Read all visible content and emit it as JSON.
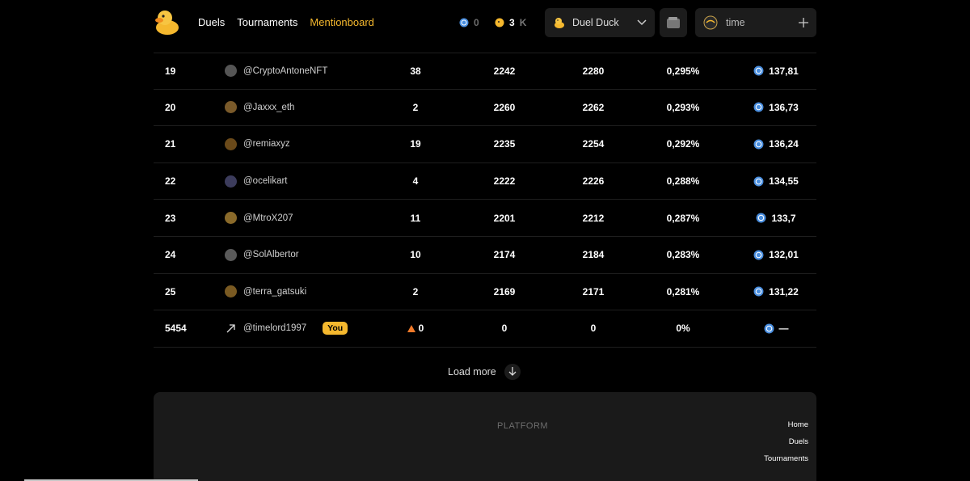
{
  "nav": {
    "items": [
      "Duels",
      "Tournaments",
      "Mentionboard"
    ],
    "active": 2
  },
  "balances": {
    "usdc": "0",
    "duck": "3",
    "duck_suffix": "K"
  },
  "selector": {
    "label": "Duel Duck"
  },
  "profile": {
    "name": "time"
  },
  "colors": {
    "accent": "#f5b82e",
    "usdc": "#4a8fe0",
    "warning": "#f07a2a"
  },
  "table": {
    "rows": [
      {
        "rank": "19",
        "user": "@CryptoAntoneNFT",
        "duels": "38",
        "a": "2242",
        "b": "2280",
        "pct": "0,295%",
        "reward": "137,81"
      },
      {
        "rank": "20",
        "user": "@Jaxxx_eth",
        "duels": "2",
        "a": "2260",
        "b": "2262",
        "pct": "0,293%",
        "reward": "136,73"
      },
      {
        "rank": "21",
        "user": "@remiaxyz",
        "duels": "19",
        "a": "2235",
        "b": "2254",
        "pct": "0,292%",
        "reward": "136,24"
      },
      {
        "rank": "22",
        "user": "@ocelikart",
        "duels": "4",
        "a": "2222",
        "b": "2226",
        "pct": "0,288%",
        "reward": "134,55"
      },
      {
        "rank": "23",
        "user": "@MtroX207",
        "duels": "11",
        "a": "2201",
        "b": "2212",
        "pct": "0,287%",
        "reward": "133,7"
      },
      {
        "rank": "24",
        "user": "@SolAlbertor",
        "duels": "10",
        "a": "2174",
        "b": "2184",
        "pct": "0,283%",
        "reward": "132,01"
      },
      {
        "rank": "25",
        "user": "@terra_gatsuki",
        "duels": "2",
        "a": "2169",
        "b": "2171",
        "pct": "0,281%",
        "reward": "131,22"
      }
    ],
    "you_row": {
      "rank": "5454",
      "user": "@timelord1997",
      "badge": "You",
      "duels": "0",
      "a": "0",
      "b": "0",
      "pct": "0%",
      "reward": "—"
    }
  },
  "load_more": {
    "label": "Load more"
  },
  "footer": {
    "heading": "PLATFORM",
    "links": [
      "Home",
      "Duels",
      "Tournaments"
    ]
  }
}
